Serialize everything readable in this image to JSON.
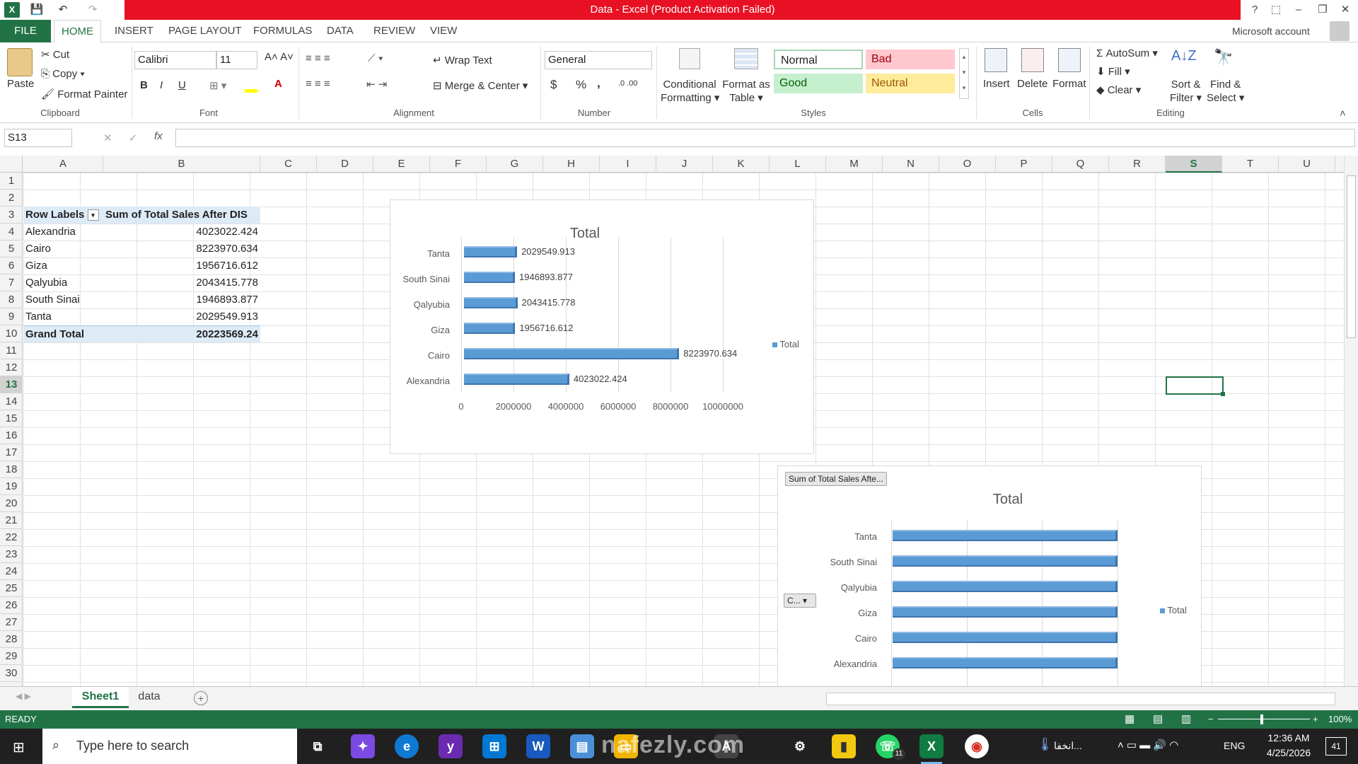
{
  "window": {
    "title": "Data - Excel (Product Activation Failed)",
    "help": "?",
    "minimize": "–",
    "restore": "❐",
    "close": "✕"
  },
  "qat": {
    "save": "💾",
    "undo": "↶",
    "redo": "↷"
  },
  "tabs": [
    "FILE",
    "HOME",
    "INSERT",
    "PAGE LAYOUT",
    "FORMULAS",
    "DATA",
    "REVIEW",
    "VIEW"
  ],
  "account": "Microsoft account",
  "ribbon": {
    "clipboard": {
      "paste": "Paste",
      "cut": "Cut",
      "copy": "Copy",
      "format_painter": "Format Painter",
      "label": "Clipboard"
    },
    "font": {
      "name": "Calibri",
      "size": "11",
      "bold": "B",
      "italic": "I",
      "underline": "U",
      "label": "Font"
    },
    "alignment": {
      "wrap": "Wrap Text",
      "merge": "Merge & Center",
      "label": "Alignment"
    },
    "number": {
      "format": "General",
      "currency": "$",
      "percent": "%",
      "comma": ",",
      "label": "Number"
    },
    "styles": {
      "conditional": "Conditional",
      "conditional2": "Formatting",
      "format_table": "Format as",
      "format_table2": "Table",
      "normal": "Normal",
      "bad": "Bad",
      "good": "Good",
      "neutral": "Neutral",
      "label": "Styles"
    },
    "cells": {
      "insert": "Insert",
      "delete": "Delete",
      "format": "Format",
      "label": "Cells"
    },
    "editing": {
      "autosum": "AutoSum",
      "fill": "Fill",
      "clear": "Clear",
      "sort": "Sort &",
      "sort2": "Filter",
      "find": "Find &",
      "find2": "Select",
      "label": "Editing"
    }
  },
  "formula": {
    "name_box": "S13",
    "fx": "fx",
    "value": ""
  },
  "columns": [
    "A",
    "B",
    "C",
    "D",
    "E",
    "F",
    "G",
    "H",
    "I",
    "J",
    "K",
    "L",
    "M",
    "N",
    "O",
    "P",
    "Q",
    "R",
    "S",
    "T",
    "U"
  ],
  "rows": [
    "1",
    "2",
    "3",
    "4",
    "5",
    "6",
    "7",
    "8",
    "9",
    "10",
    "11",
    "12",
    "13",
    "14",
    "15",
    "16",
    "17",
    "18",
    "19",
    "20",
    "21",
    "22",
    "23",
    "24",
    "25",
    "26",
    "27",
    "28",
    "29",
    "30"
  ],
  "pivot": {
    "header_label": "Row Labels",
    "header_value": "Sum of Total Sales After DIS",
    "rows": [
      {
        "label": "Alexandria",
        "value": "4023022.424"
      },
      {
        "label": "Cairo",
        "value": "8223970.634"
      },
      {
        "label": "Giza",
        "value": "1956716.612"
      },
      {
        "label": "Qalyubia",
        "value": "2043415.778"
      },
      {
        "label": "South Sinai",
        "value": "1946893.877"
      },
      {
        "label": "Tanta",
        "value": "2029549.913"
      }
    ],
    "total_label": "Grand Total",
    "total_value": "20223569.24"
  },
  "chart_data": [
    {
      "type": "bar",
      "title": "Total",
      "categories": [
        "Tanta",
        "South Sinai",
        "Qalyubia",
        "Giza",
        "Cairo",
        "Alexandria"
      ],
      "series": [
        {
          "name": "Total",
          "values": [
            2029549.913,
            1946893.877,
            2043415.778,
            1956716.612,
            8223970.634,
            4023022.424
          ]
        }
      ],
      "data_labels": [
        "2029549.913",
        "1946893.877",
        "2043415.778",
        "1956716.612",
        "8223970.634",
        "4023022.424"
      ],
      "xlim": [
        0,
        10000000
      ],
      "xticks": [
        "0",
        "2000000",
        "4000000",
        "6000000",
        "8000000",
        "10000000"
      ],
      "legend": "right",
      "color": "#5b9bd5"
    },
    {
      "type": "bar",
      "title": "Total",
      "field_button": "Sum of Total Sales Afte...",
      "axis_button": "C...",
      "categories": [
        "Tanta",
        "South Sinai",
        "Qalyubia",
        "Giza",
        "Cairo",
        "Alexandria"
      ],
      "series": [
        {
          "name": "Total"
        }
      ],
      "legend": "right",
      "color": "#5b9bd5"
    }
  ],
  "sheets": {
    "active": "Sheet1",
    "other": "data",
    "add": "+"
  },
  "status": {
    "mode": "READY",
    "zoom": "100%"
  },
  "taskbar": {
    "search": "Type here to search",
    "time": "12:36 AM",
    "date": "4/25/2026",
    "lang": "ENG",
    "notif": "41",
    "arabic": "انخفا...",
    "whatsapp_badge": "11"
  },
  "watermark": "nafezly.com"
}
